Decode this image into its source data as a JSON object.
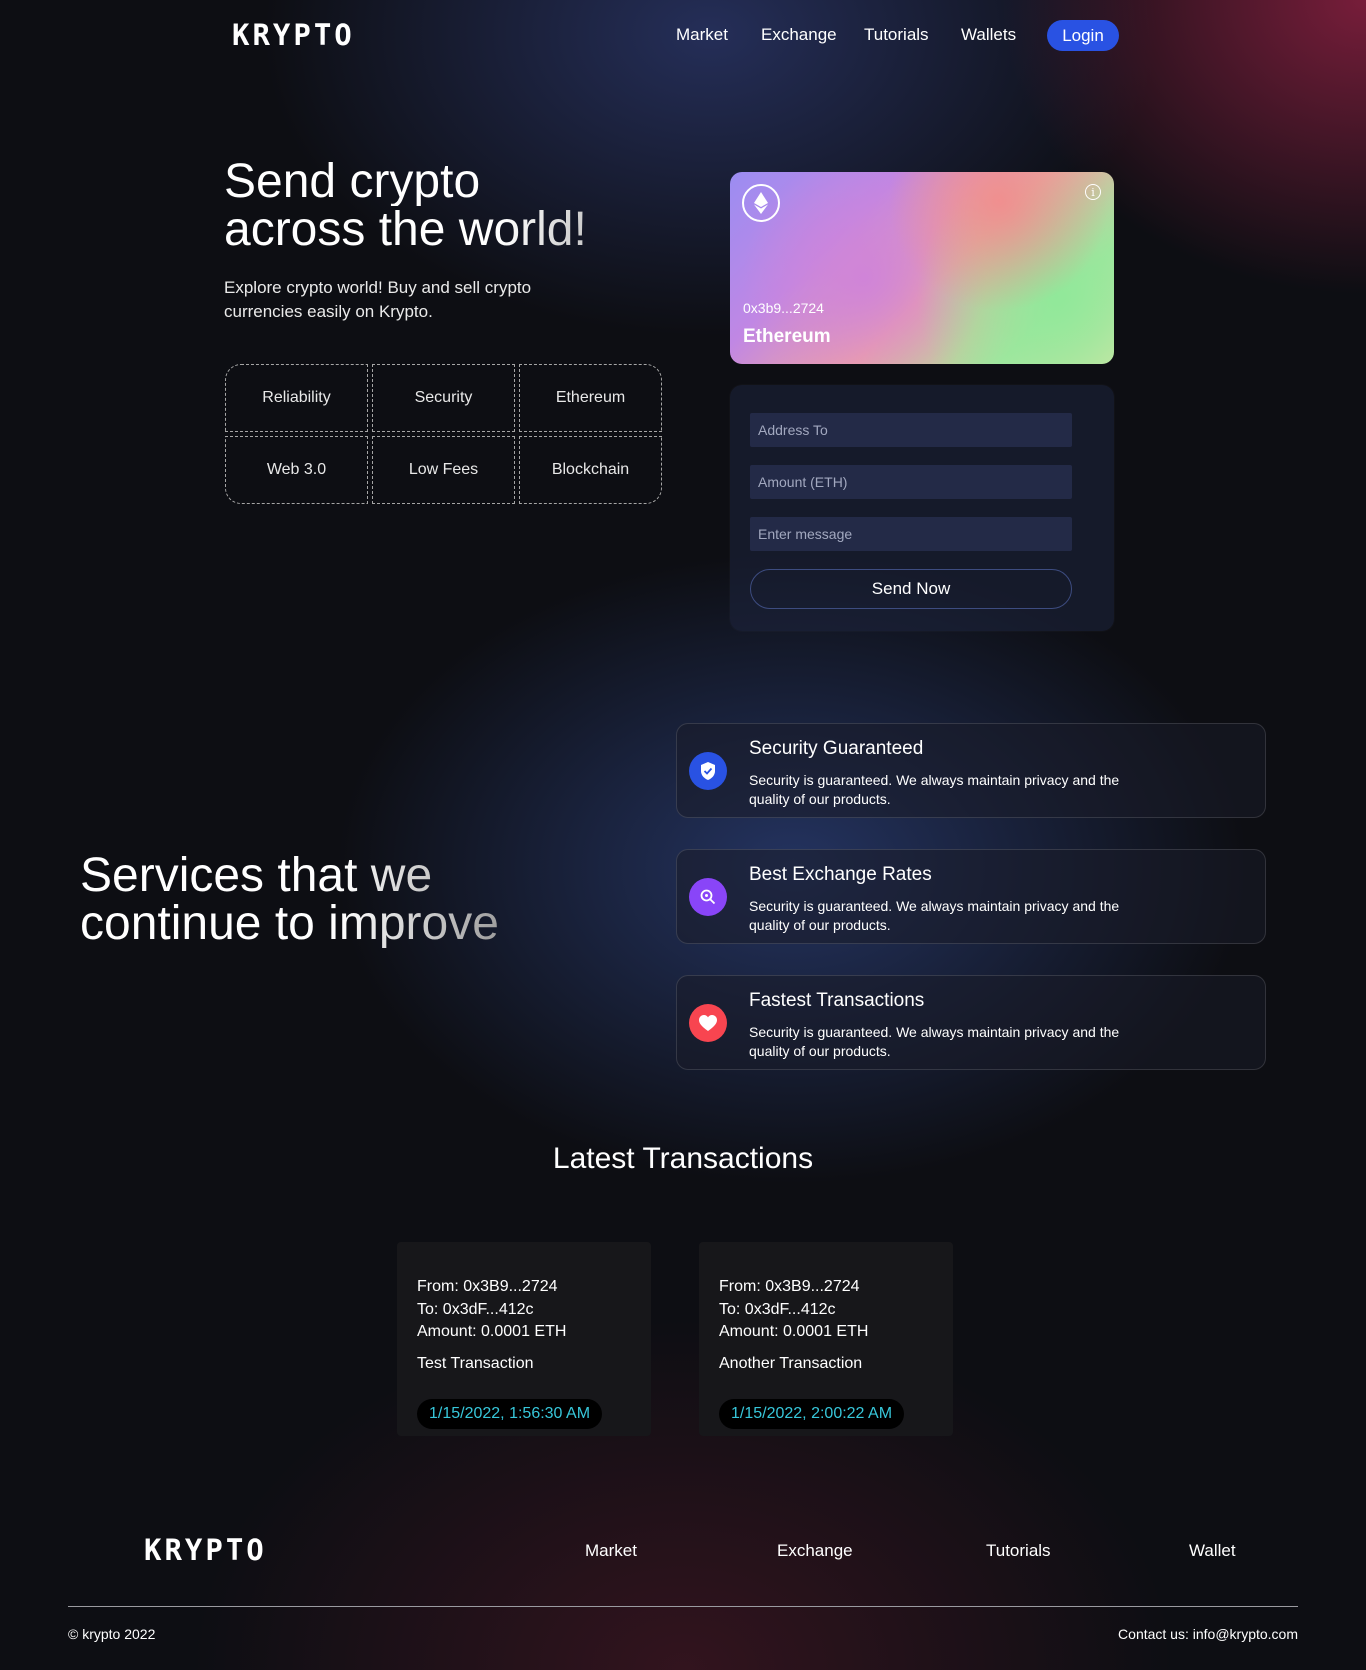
{
  "brand": {
    "logo_text": "KRYPTO"
  },
  "nav": {
    "links": [
      "Market",
      "Exchange",
      "Tutorials",
      "Wallets"
    ],
    "login_label": "Login"
  },
  "hero": {
    "title_line1": "Send crypto",
    "title_line2": "across the world!",
    "description": "Explore crypto world! Buy and sell crypto currencies easily on Krypto.",
    "features": [
      "Reliability",
      "Security",
      "Ethereum",
      "Web 3.0",
      "Low Fees",
      "Blockchain"
    ]
  },
  "card": {
    "coin_icon": "ethereum-icon",
    "info_icon": "info-icon",
    "address": "0x3b9...2724",
    "name": "Ethereum"
  },
  "form": {
    "address_placeholder": "Address To",
    "amount_placeholder": "Amount (ETH)",
    "message_placeholder": "Enter message",
    "send_label": "Send Now"
  },
  "services": {
    "title_line1": "Services that we",
    "title_line2": "continue to improve",
    "items": [
      {
        "title": "Security Guaranteed",
        "text": "Security is guaranteed. We always maintain privacy and the quality of our products.",
        "icon": "shield-icon",
        "color": "#2952e3"
      },
      {
        "title": "Best Exchange Rates",
        "text": "Security is guaranteed. We always maintain privacy and the quality of our products.",
        "icon": "search-icon",
        "color": "#8945f8"
      },
      {
        "title": "Fastest Transactions",
        "text": "Security is guaranteed. We always maintain privacy and the quality of our products.",
        "icon": "heart-icon",
        "color": "#f84550"
      }
    ]
  },
  "transactions": {
    "title": "Latest Transactions",
    "items": [
      {
        "from": "From: 0x3B9...2724",
        "to": "To: 0x3dF...412c",
        "amount": "Amount: 0.0001 ETH",
        "message": "Test Transaction",
        "timestamp": "1/15/2022, 1:56:30 AM"
      },
      {
        "from": "From: 0x3B9...2724",
        "to": "To: 0x3dF...412c",
        "amount": "Amount: 0.0001 ETH",
        "message": "Another Transaction",
        "timestamp": "1/15/2022, 2:00:22 AM"
      }
    ]
  },
  "footer": {
    "logo_text": "KRYPTO",
    "links": [
      "Market",
      "Exchange",
      "Tutorials",
      "Wallet"
    ],
    "copyright": "© krypto 2022",
    "contact": "Contact us: info@krypto.com"
  },
  "colors": {
    "accent": "#2952e3",
    "timestamp": "#37c7da"
  }
}
